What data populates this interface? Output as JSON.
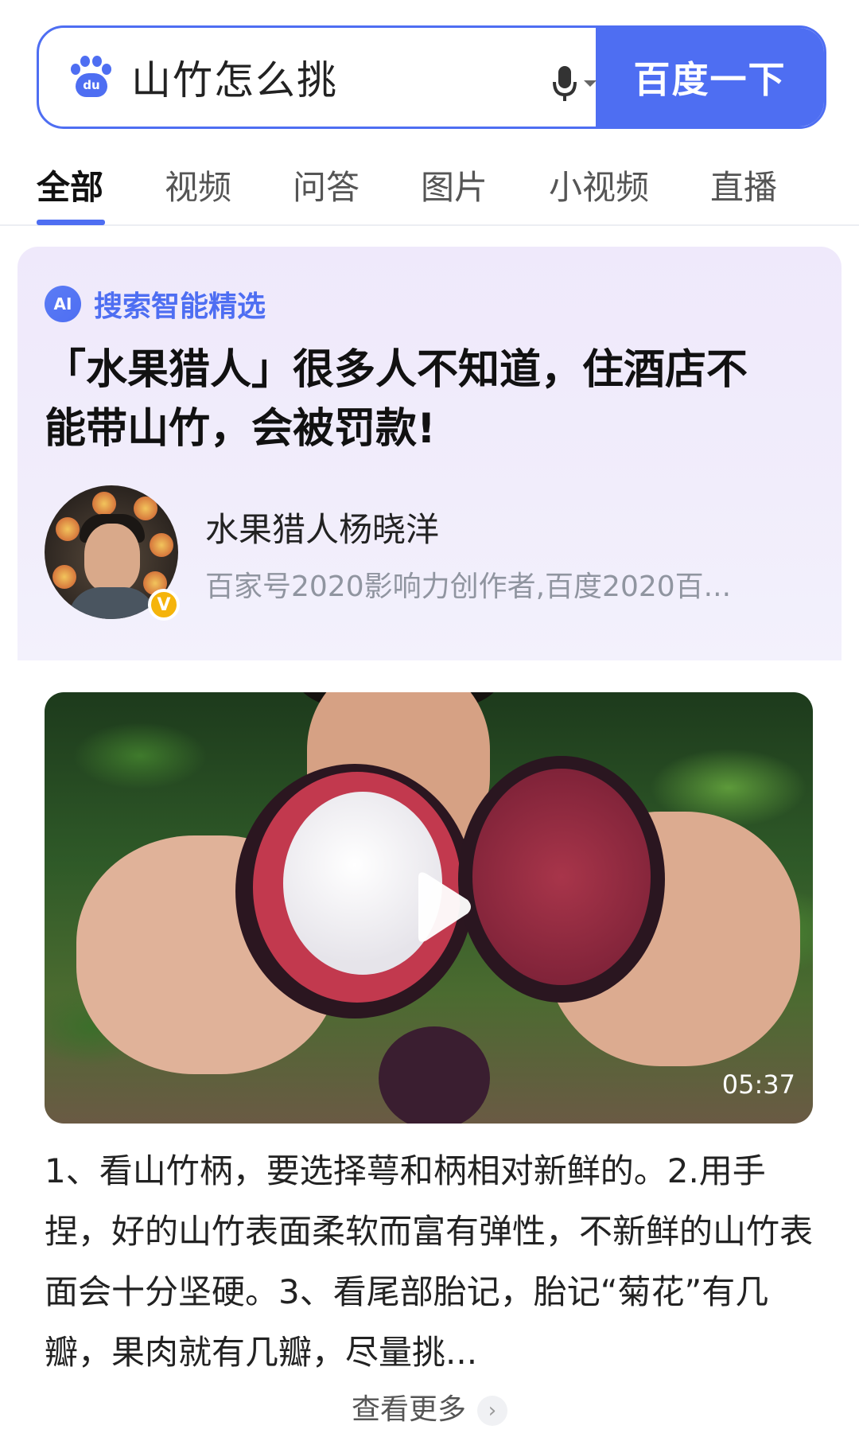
{
  "search": {
    "query": "山竹怎么挑",
    "button_label": "百度一下",
    "logo_text": "du"
  },
  "tabs": [
    {
      "label": "全部",
      "active": true
    },
    {
      "label": "视频",
      "active": false
    },
    {
      "label": "问答",
      "active": false
    },
    {
      "label": "图片",
      "active": false
    },
    {
      "label": "小视频",
      "active": false
    },
    {
      "label": "直播",
      "active": false
    }
  ],
  "ai_card": {
    "badge": "AI",
    "label": "搜索智能精选",
    "title": "「水果猎人」很多人不知道，住酒店不能带山竹，会被罚款!",
    "author_name": "水果猎人杨晓洋",
    "author_desc": "百家号2020影响力创作者,百度2020百...",
    "verified_badge": "V"
  },
  "video": {
    "duration": "05:37"
  },
  "summary": "1、看山竹柄，要选择萼和柄相对新鲜的。2.用手捏，好的山竹表面柔软而富有弹性，不新鲜的山竹表面会十分坚硬。3、看尾部胎记，胎记“菊花”有几瓣，果肉就有几瓣，尽量挑...",
  "more_label": "查看更多",
  "colors": {
    "accent": "#4e6ef2",
    "ai_bg": "#efe9fb",
    "verified": "#f5b40a"
  }
}
